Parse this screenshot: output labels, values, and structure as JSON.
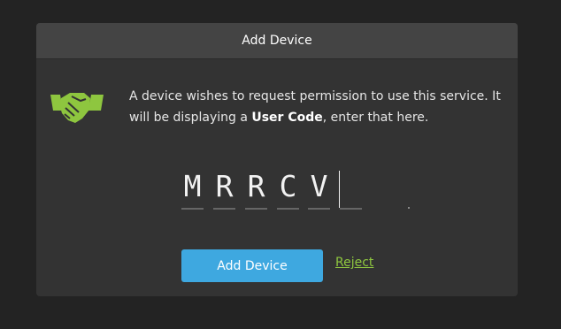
{
  "dialog": {
    "title": "Add Device",
    "message_part1": "A device wishes to request permission to use this service. It will be displaying a ",
    "message_bold": "User Code",
    "message_part2": ", enter that here.",
    "icon": "handshake-icon",
    "code": [
      "M",
      "R",
      "R",
      "C",
      "V",
      ""
    ],
    "add_button_label": "Add Device",
    "reject_label": "Reject"
  },
  "colors": {
    "background": "#232323",
    "dialog": "#333333",
    "header": "#444444",
    "accent_blue": "#3ea8e0",
    "accent_green": "#8ec63f"
  }
}
